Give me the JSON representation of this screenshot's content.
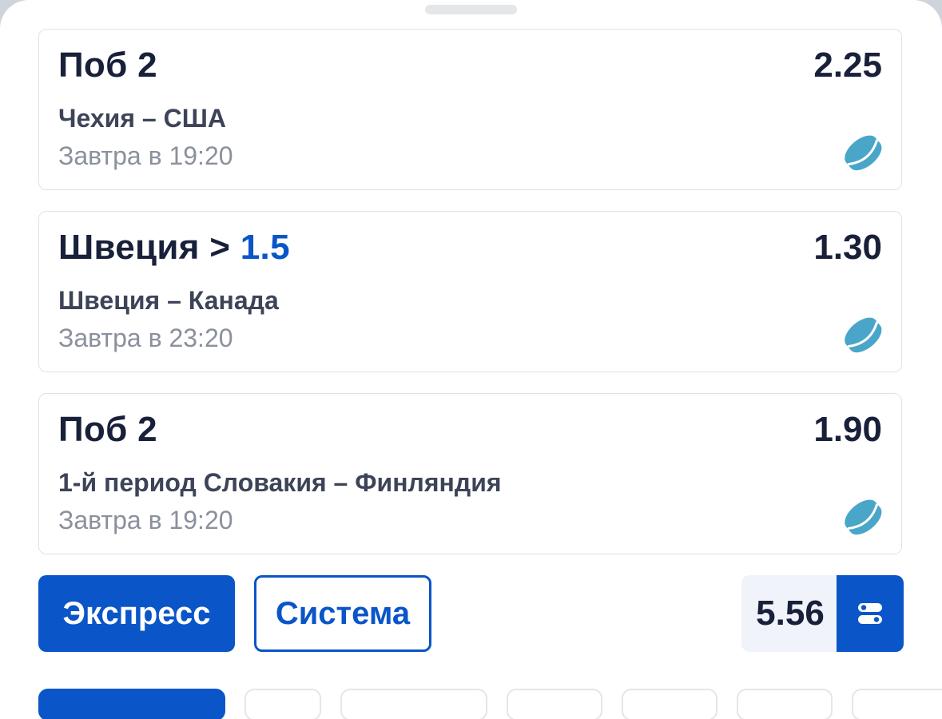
{
  "bets": [
    {
      "title": "Поб 2",
      "title_highlight": "",
      "odds": "2.25",
      "match": "Чехия – США",
      "time": "Завтра в 19:20",
      "sport_icon": "hockey-puck-icon"
    },
    {
      "title": "Швеция > ",
      "title_highlight": "1.5",
      "odds": "1.30",
      "match": "Швеция – Канада",
      "time": "Завтра в 23:20",
      "sport_icon": "hockey-puck-icon"
    },
    {
      "title": "Поб 2",
      "title_highlight": "",
      "odds": "1.90",
      "match": "1-й период Словакия – Финляндия",
      "time": "Завтра в 19:20",
      "sport_icon": "hockey-puck-icon"
    }
  ],
  "bet_type": {
    "express_label": "Экспресс",
    "system_label": "Система",
    "selected": "Экспресс"
  },
  "total_odds": "5.56",
  "settings_icon": "toggle-settings-icon",
  "colors": {
    "accent": "#0a55c8",
    "text_dark": "#18203a",
    "text_muted": "#8a909c",
    "puck": "#4aa6c8"
  }
}
